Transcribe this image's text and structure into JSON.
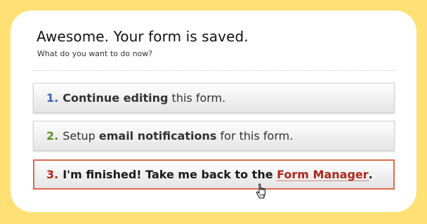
{
  "dialog": {
    "title": "Awesome. Your form is saved.",
    "subtitle": "What do you want to do now?"
  },
  "options": [
    {
      "number": "1.",
      "bold_text": "Continue editing",
      "text_after": " this form.",
      "number_color": "#3a62ad"
    },
    {
      "number": "2.",
      "text_before": "Setup ",
      "bold_text": "email notifications",
      "text_after": " for this form.",
      "number_color": "#5c8f24"
    },
    {
      "number": "3.",
      "text_before": "I'm finished! Take me back to the ",
      "link_text": "Form Manager",
      "text_after": ".",
      "number_color": "#b0281a",
      "highlight_border": "#e06a4e"
    }
  ],
  "icons": {
    "cursor": "hand-pointer-icon"
  },
  "colors": {
    "background": "#ffe074",
    "dialog": "#ffffff"
  }
}
